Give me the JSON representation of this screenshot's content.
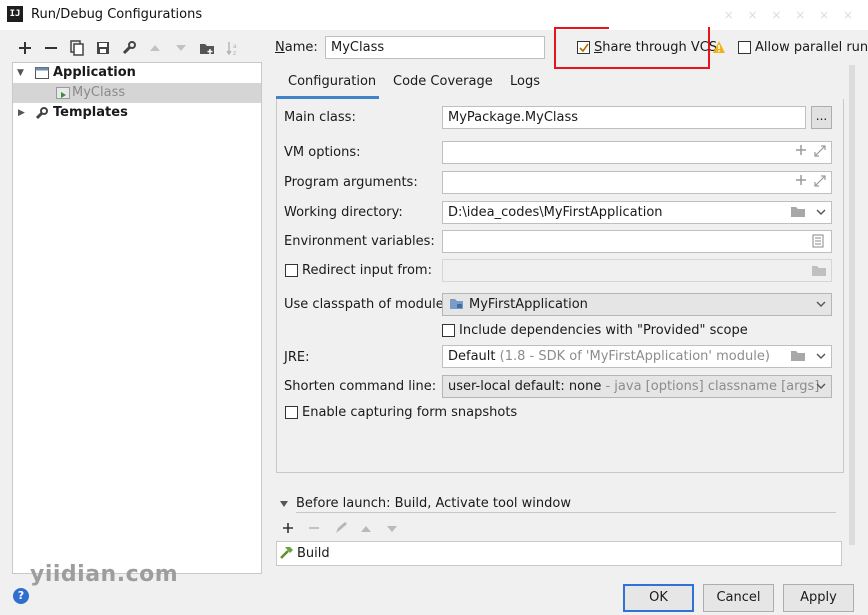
{
  "window": {
    "title": "Run/Debug Configurations",
    "app_icon": "IJ",
    "watermark_top": "× × × × × ×"
  },
  "toolbar": {
    "icons": [
      "plus-icon",
      "minus-icon",
      "copy-icon",
      "save-icon",
      "wrench-icon",
      "arrow-up-icon",
      "arrow-down-icon",
      "folder-add-icon",
      "sort-icon"
    ]
  },
  "tree": {
    "application": "Application",
    "myclass": "MyClass",
    "templates": "Templates"
  },
  "header": {
    "name_label_u": "N",
    "name_label_rest": "ame:",
    "name_value": "MyClass",
    "share_label_u": "S",
    "share_label_rest": "hare through VCS",
    "share_checked": true,
    "parallel_label": "Allow parallel run",
    "parallel_label_u": "u",
    "highlight_color": "#e8141b"
  },
  "tabs": [
    {
      "label": "Configuration",
      "active": true
    },
    {
      "label": "Code Coverage",
      "active": false
    },
    {
      "label": "Logs",
      "active": false
    }
  ],
  "config": {
    "main_class_label": "Main class:",
    "main_class_value": "MyPackage.MyClass",
    "browse_button": "...",
    "vm_options_label": "VM options:",
    "program_args_label": "Program arguments:",
    "working_dir_label": "Working directory:",
    "working_dir_value": "D:\\idea_codes\\MyFirstApplication",
    "env_vars_label": "Environment variables:",
    "redirect_label": "Redirect input from:",
    "classpath_label": "Use classpath of module:",
    "classpath_value": "MyFirstApplication",
    "include_deps_label": "Include dependencies with \"Provided\" scope",
    "jre_label": "JRE:",
    "jre_value_main": "Default",
    "jre_value_sub": "(1.8 - SDK of 'MyFirstApplication' module)",
    "shorten_label": "Shorten command line:",
    "shorten_value_main": "user-local default: none",
    "shorten_value_sub": "- java [options] classname [args]",
    "snapshots_label": "Enable capturing form snapshots"
  },
  "before_launch": {
    "title": "Before launch: Build, Activate tool window",
    "item": "Build"
  },
  "buttons": {
    "ok": "OK",
    "cancel": "Cancel",
    "apply": "Apply"
  },
  "watermark": "yiidian.com",
  "help": "?"
}
